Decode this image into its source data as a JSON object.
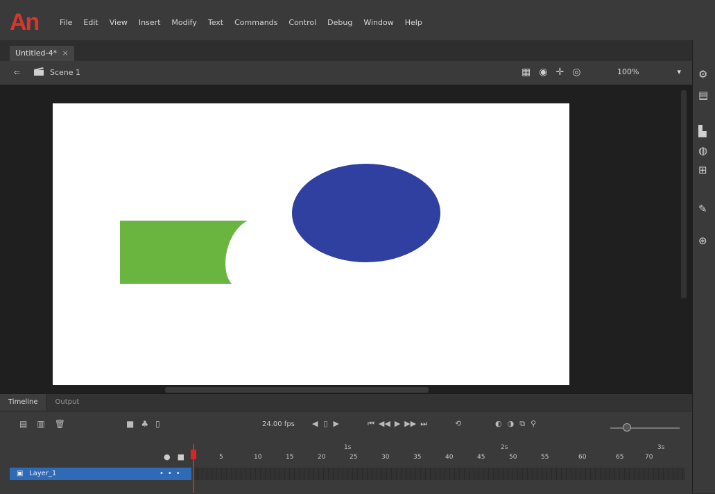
{
  "menubar": {
    "logo": "An",
    "items": [
      "File",
      "Edit",
      "View",
      "Insert",
      "Modify",
      "Text",
      "Commands",
      "Control",
      "Debug",
      "Window",
      "Help"
    ]
  },
  "document": {
    "tab_label": "Untitled-4*",
    "close_glyph": "×"
  },
  "edit_bar": {
    "back_glyph": "⇐",
    "scene_label": "Scene 1",
    "zoom_value": "100%",
    "zoom_arrow": "▾"
  },
  "stage": {
    "background": "#ffffff",
    "rectangle_color": "#6ab53f",
    "ellipse_color": "#2f40a0"
  },
  "timeline": {
    "tabs": [
      "Timeline",
      "Output"
    ],
    "fps": "24.00 fps",
    "ruler_numbers": [
      "5",
      "10",
      "15",
      "20",
      "25",
      "30",
      "35",
      "40",
      "45",
      "50",
      "55",
      "60",
      "65",
      "70"
    ],
    "ruler_seconds": [
      "1s",
      "2s",
      "3s"
    ],
    "layer_name": "Layer_1"
  },
  "icons": {
    "scene": "clapper-icon",
    "right_panel": [
      "properties-icon",
      "library-icon",
      "align-icon",
      "color-icon",
      "transform-icon",
      "brush-icon",
      "components-icon"
    ]
  }
}
